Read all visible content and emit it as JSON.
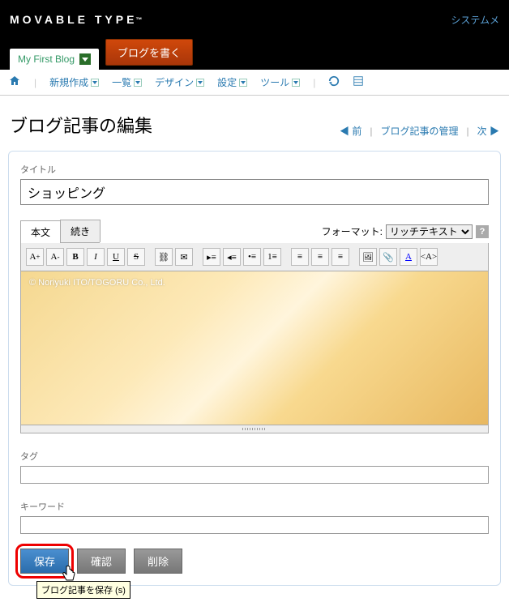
{
  "header": {
    "logo_text": "MOVABLE TYPE",
    "logo_tm": "™",
    "system_link": "システムメ"
  },
  "blog_tabs": {
    "current": "My First Blog",
    "write_button": "ブログを書く"
  },
  "menu": {
    "items": [
      "新規作成",
      "一覧",
      "デザイン",
      "設定",
      "ツール"
    ]
  },
  "page": {
    "title": "ブログ記事の編集",
    "nav_prev": "◀ 前",
    "nav_manage": "ブログ記事の管理",
    "nav_next": "次 ▶"
  },
  "fields": {
    "title_label": "タイトル",
    "title_value": "ショッピング",
    "tag_label": "タグ",
    "tag_value": "",
    "keyword_label": "キーワード",
    "keyword_value": ""
  },
  "editor": {
    "tab_body": "本文",
    "tab_more": "続き",
    "format_label": "フォーマット:",
    "format_value": "リッチテキスト",
    "copyright": "© Noriyuki ITO/TOGORU Co., Ltd."
  },
  "actions": {
    "save": "保存",
    "confirm": "確認",
    "delete": "削除",
    "tooltip": "ブログ記事を保存 (s)"
  }
}
